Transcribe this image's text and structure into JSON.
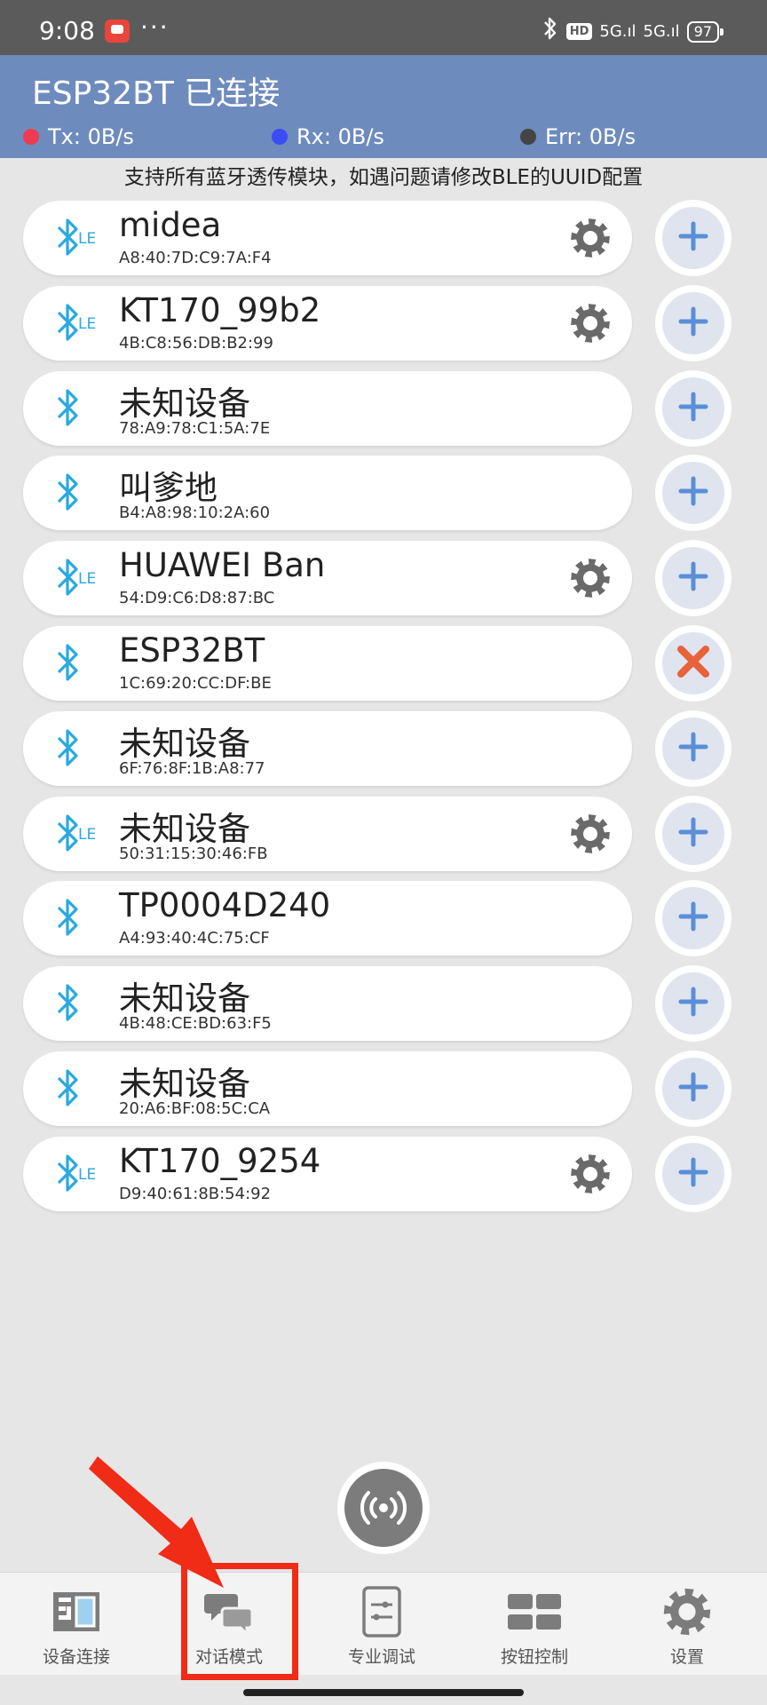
{
  "status_bar": {
    "time": "9:08",
    "dots": "···",
    "hd": "HD",
    "sig1": "5G.ıl",
    "sig2": "5G.ıl",
    "battery": "97"
  },
  "header": {
    "title": "ESP32BT 已连接",
    "tx": "Tx: 0B/s",
    "rx": "Rx: 0B/s",
    "err": "Err: 0B/s",
    "colors": {
      "bar": "#6e8bbd",
      "tx": "#ef3b4f",
      "rx": "#3b4cf5",
      "err": "#444444"
    }
  },
  "notice": "支持所有蓝牙透传模块，如遇问题请修改BLE的UUID配置",
  "devices": [
    {
      "name": "midea",
      "mac": "A8:40:7D:C9:7A:F4",
      "icon": "bluetooth-le-icon",
      "settings": true,
      "action": "add"
    },
    {
      "name": "KT170_99b2",
      "mac": "4B:C8:56:DB:B2:99",
      "icon": "bluetooth-le-icon",
      "settings": true,
      "action": "add"
    },
    {
      "name": "未知设备",
      "mac": "78:A9:78:C1:5A:7E",
      "icon": "bluetooth-icon",
      "settings": false,
      "action": "add"
    },
    {
      "name": "叫爹地",
      "mac": "B4:A8:98:10:2A:60",
      "icon": "bluetooth-icon",
      "settings": false,
      "action": "add"
    },
    {
      "name": "HUAWEI Ban",
      "mac": "54:D9:C6:D8:87:BC",
      "icon": "bluetooth-le-icon",
      "settings": true,
      "action": "add"
    },
    {
      "name": "ESP32BT",
      "mac": "1C:69:20:CC:DF:BE",
      "icon": "bluetooth-icon",
      "settings": false,
      "action": "disconnect"
    },
    {
      "name": "未知设备",
      "mac": "6F:76:8F:1B:A8:77",
      "icon": "bluetooth-icon",
      "settings": false,
      "action": "add"
    },
    {
      "name": "未知设备",
      "mac": "50:31:15:30:46:FB",
      "icon": "bluetooth-le-icon",
      "settings": true,
      "action": "add"
    },
    {
      "name": "TP0004D240",
      "mac": "A4:93:40:4C:75:CF",
      "icon": "bluetooth-icon",
      "settings": false,
      "action": "add"
    },
    {
      "name": "未知设备",
      "mac": "4B:48:CE:BD:63:F5",
      "icon": "bluetooth-icon",
      "settings": false,
      "action": "add"
    },
    {
      "name": "未知设备",
      "mac": "20:A6:BF:08:5C:CA",
      "icon": "bluetooth-icon",
      "settings": false,
      "action": "add"
    },
    {
      "name": "KT170_9254",
      "mac": "D9:40:61:8B:54:92",
      "icon": "bluetooth-le-icon",
      "settings": true,
      "action": "add"
    }
  ],
  "nav": {
    "items": [
      {
        "label": "设备连接",
        "icon": "device-connect-icon"
      },
      {
        "label": "对话模式",
        "icon": "chat-icon"
      },
      {
        "label": "专业调试",
        "icon": "debug-icon"
      },
      {
        "label": "按钮控制",
        "icon": "button-grid-icon"
      },
      {
        "label": "设置",
        "icon": "gear-icon"
      }
    ]
  },
  "colors": {
    "bt_blue": "#29a9df",
    "plus_blue": "#5a8fd8",
    "close_orange": "#e8623a",
    "gear_gray": "#6a6a6a",
    "annotation_red": "#f02b16"
  }
}
